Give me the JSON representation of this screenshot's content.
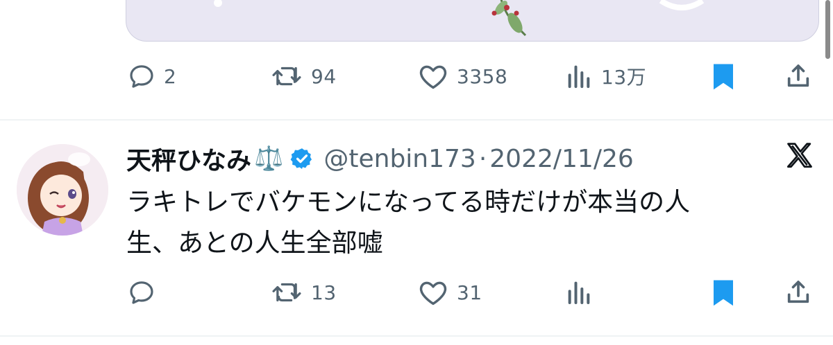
{
  "first_tweet": {
    "actions": {
      "reply_count": "2",
      "retweet_count": "94",
      "like_count": "3358",
      "views_count": "13万"
    }
  },
  "second_tweet": {
    "display_name": "天秤ひなみ",
    "name_emoji": "⚖️",
    "handle": "@tenbin173",
    "separator": "·",
    "date": "2022/11/26",
    "text_line1": "ラキトレでバケモンになってる時だけが本当の人",
    "text_line2": "生、あとの人生全部嘘",
    "actions": {
      "reply_count": "",
      "retweet_count": "13",
      "like_count": "31",
      "views_count": ""
    }
  },
  "colors": {
    "accent": "#1d9bf0",
    "muted": "#536471",
    "text": "#0f1419",
    "divider": "#eff3f4"
  },
  "icons": [
    "reply-icon",
    "retweet-icon",
    "like-icon",
    "views-icon",
    "bookmark-icon",
    "share-icon",
    "verified-icon",
    "x-logo-icon"
  ]
}
